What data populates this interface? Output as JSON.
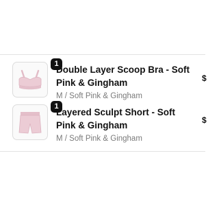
{
  "line_items": [
    {
      "quantity": "1",
      "title": "Double Layer Scoop Bra - Soft Pink & Gingham",
      "variant": "M / Soft Pink & Gingham",
      "thumbnail_icon": "sports-bra-icon"
    },
    {
      "quantity": "1",
      "title": "Layered Sculpt Short - Soft Pink & Gingham",
      "variant": "M / Soft Pink & Gingham",
      "thumbnail_icon": "shorts-icon"
    }
  ],
  "clipped_right_edge": [
    {
      "text": "$"
    },
    {
      "text": "$"
    }
  ],
  "colors": {
    "background": "#ffffff",
    "title": "#111111",
    "variant": "#7a7a7a",
    "badge": "#111111",
    "product_pink": "#e9c9d2"
  }
}
